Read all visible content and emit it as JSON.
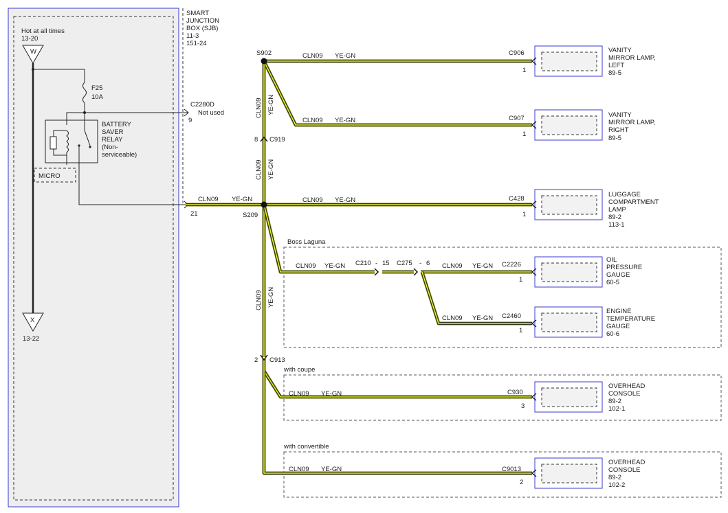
{
  "sjb": {
    "name_lines": [
      "SMART",
      "JUNCTION",
      "BOX (SJB)"
    ],
    "refs": [
      "11-3",
      "151-24"
    ],
    "hot_label": "Hot at all times",
    "hot_ref": "13-20",
    "top_terminal": "W",
    "bottom_terminal": "X",
    "bottom_ref": "13-22",
    "fuse_name": "F25",
    "fuse_rating": "10A",
    "relay_lines": [
      "BATTERY",
      "SAVER",
      "RELAY",
      "(Non-",
      "serviceable)"
    ],
    "micro_label": "MICRO",
    "unused_connector": "C2280D",
    "unused_label": "Not used",
    "unused_pin": "9",
    "output_pin": "21"
  },
  "wire": {
    "circuit": "CLN09",
    "color": "YE-GN",
    "colors_hex": {
      "outer": "#6b7a00",
      "stripe": "#e8ef2a",
      "core": "#222222"
    }
  },
  "splices": {
    "top": "S902",
    "main": "S209"
  },
  "inline_connectors": {
    "c919": {
      "name": "C919",
      "pin": "8"
    },
    "c913": {
      "name": "C913",
      "pin": "2"
    },
    "c210": "C210",
    "c210_pin": "15",
    "c275": "C275",
    "c275_pin": "6"
  },
  "sections": {
    "boss": "Boss Laguna",
    "coupe": "with coupe",
    "convertible": "with convertible"
  },
  "devices": [
    {
      "connector": "C906",
      "pin": "1",
      "lines": [
        "VANITY",
        "MIRROR LAMP,",
        "LEFT",
        "89-5"
      ]
    },
    {
      "connector": "C907",
      "pin": "1",
      "lines": [
        "VANITY",
        "MIRROR LAMP,",
        "RIGHT",
        "89-5"
      ]
    },
    {
      "connector": "C428",
      "pin": "1",
      "lines": [
        "LUGGAGE",
        "COMPARTMENT",
        "LAMP",
        "89-2",
        "113-1"
      ]
    },
    {
      "connector": "C2226",
      "pin": "1",
      "lines": [
        "OIL",
        "PRESSURE",
        "GAUGE",
        "60-5"
      ]
    },
    {
      "connector": "C2460",
      "pin": "1",
      "lines": [
        "ENGINE",
        "TEMPERATURE",
        "GAUGE",
        "60-6"
      ]
    },
    {
      "connector": "C930",
      "pin": "3",
      "lines": [
        "OVERHEAD",
        "CONSOLE",
        "89-2",
        "102-1"
      ]
    },
    {
      "connector": "C9013",
      "pin": "2",
      "lines": [
        "OVERHEAD",
        "CONSOLE",
        "89-2",
        "102-2"
      ]
    }
  ]
}
